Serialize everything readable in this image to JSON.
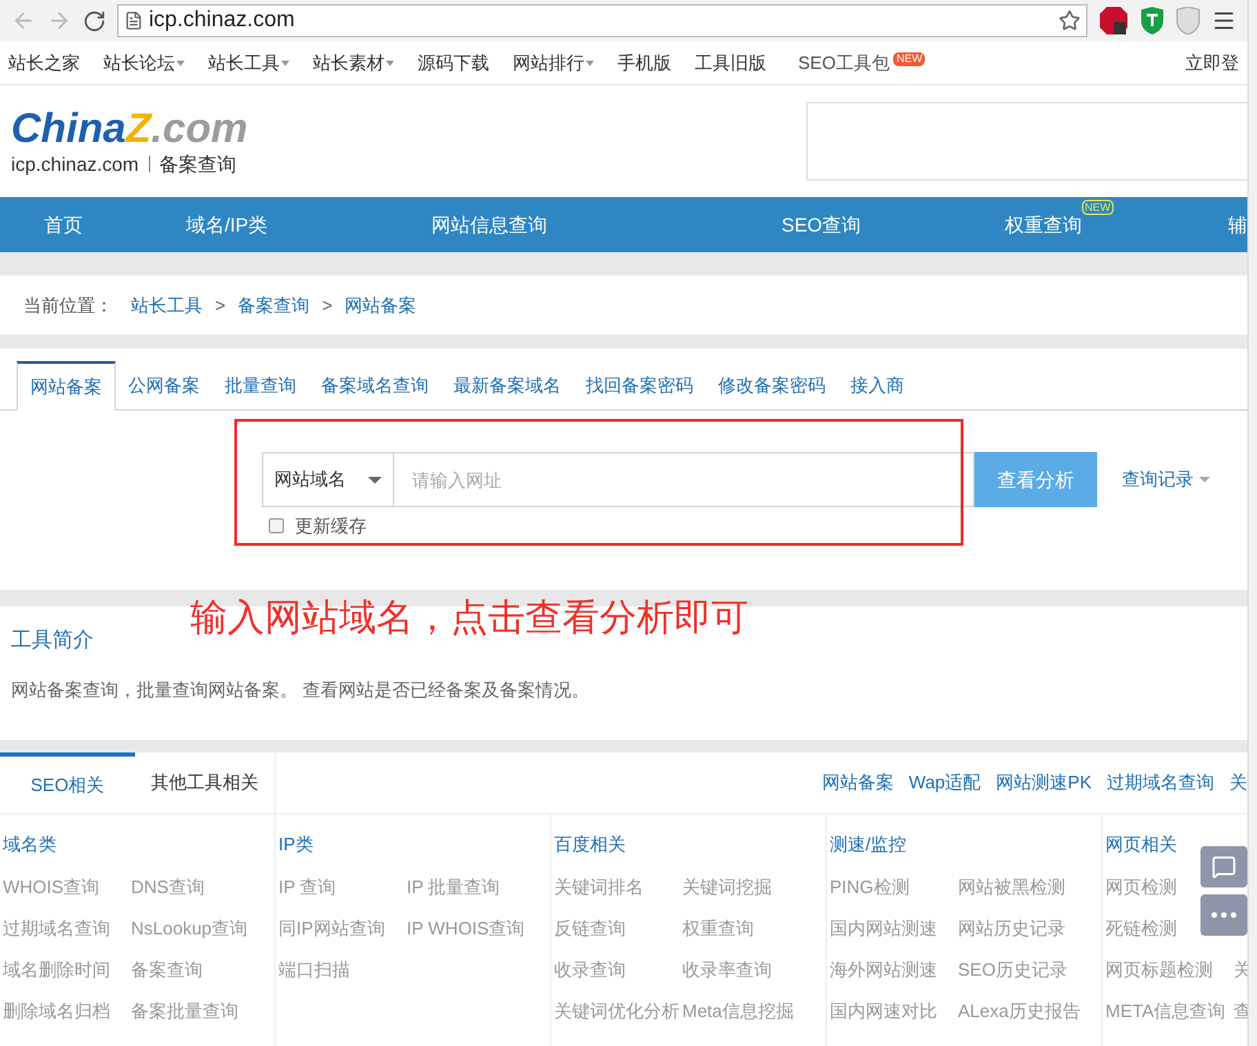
{
  "browser": {
    "url": "icp.chinaz.com"
  },
  "bookmarks": [
    {
      "label": "站长之家",
      "dropdown": false
    },
    {
      "label": "站长论坛",
      "dropdown": true
    },
    {
      "label": "站长工具",
      "dropdown": true
    },
    {
      "label": "站长素材",
      "dropdown": true
    },
    {
      "label": "源码下载",
      "dropdown": false
    },
    {
      "label": "网站排行",
      "dropdown": true
    },
    {
      "label": "手机版",
      "dropdown": false
    },
    {
      "label": "工具旧版",
      "dropdown": false
    },
    {
      "label": "SEO工具包",
      "dropdown": false,
      "badge": "NEW"
    }
  ],
  "login": "立即登",
  "logo": {
    "brand": "China",
    "mark": "Z",
    "suffix": ".com",
    "domain": "icp.chinaz.com",
    "section": "备案查询"
  },
  "nav": [
    {
      "label": "首页"
    },
    {
      "label": "域名/IP类"
    },
    {
      "label": "网站信息查询"
    },
    {
      "label": "SEO查询"
    },
    {
      "label": "权重查询",
      "badge": "NEW"
    },
    {
      "label": "辅"
    }
  ],
  "breadcrumb": {
    "label": "当前位置：",
    "items": [
      "站长工具",
      "备案查询",
      "网站备案"
    ],
    "separator": ">"
  },
  "tabs": [
    {
      "label": "网站备案",
      "selected": true
    },
    {
      "label": "公网备案",
      "selected": false
    },
    {
      "label": "批量查询",
      "selected": false
    },
    {
      "label": "备案域名查询",
      "selected": false
    },
    {
      "label": "最新备案域名",
      "selected": false
    },
    {
      "label": "找回备案密码",
      "selected": false
    },
    {
      "label": "修改备案密码",
      "selected": false
    },
    {
      "label": "接入商",
      "selected": false
    }
  ],
  "search": {
    "select": "网站域名",
    "placeholder": "请输入网址",
    "button": "查看分析",
    "history": "查询记录",
    "refresh": {
      "label": "更新缓存",
      "checked": false
    }
  },
  "annotation": "输入网站域名，点击查看分析即可",
  "intro": {
    "title": "工具简介",
    "text": "网站备案查询，批量查询网站备案。 查看网站是否已经备案及备案情况。"
  },
  "tool_tabs": [
    {
      "label": "SEO相关",
      "selected": true
    },
    {
      "label": "其他工具相关",
      "selected": false
    }
  ],
  "quick_links": [
    "网站备案",
    "Wap适配",
    "网站测速PK",
    "过期域名查询",
    "关"
  ],
  "columns": [
    {
      "title": "域名类",
      "rows": [
        [
          "WHOIS查询",
          "DNS查询"
        ],
        [
          "过期域名查询",
          "NsLookup查询"
        ],
        [
          "域名删除时间",
          "备案查询"
        ],
        [
          "删除域名归档",
          "备案批量查询"
        ]
      ]
    },
    {
      "title": "IP类",
      "rows": [
        [
          "IP 查询",
          "IP 批量查询"
        ],
        [
          "同IP网站查询",
          "IP WHOIS查询"
        ],
        [
          "端口扫描"
        ]
      ]
    },
    {
      "title": "百度相关",
      "rows": [
        [
          "关键词排名",
          "关键词挖掘"
        ],
        [
          "反链查询",
          "权重查询"
        ],
        [
          "收录查询",
          "收录率查询"
        ],
        [
          "关键词优化分析",
          "Meta信息挖掘"
        ]
      ]
    },
    {
      "title": "测速/监控",
      "rows": [
        [
          "PING检测",
          "网站被黑检测"
        ],
        [
          "国内网站测速",
          "网站历史记录"
        ],
        [
          "海外网站测速",
          "SEO历史记录"
        ],
        [
          "国内网速对比",
          "ALexa历史报告"
        ]
      ]
    },
    {
      "title": "网页相关",
      "rows": [
        [
          "网页检测"
        ],
        [
          "死链检测"
        ],
        [
          "网页标题检测",
          "关"
        ],
        [
          "META信息查询",
          "查"
        ]
      ]
    }
  ]
}
